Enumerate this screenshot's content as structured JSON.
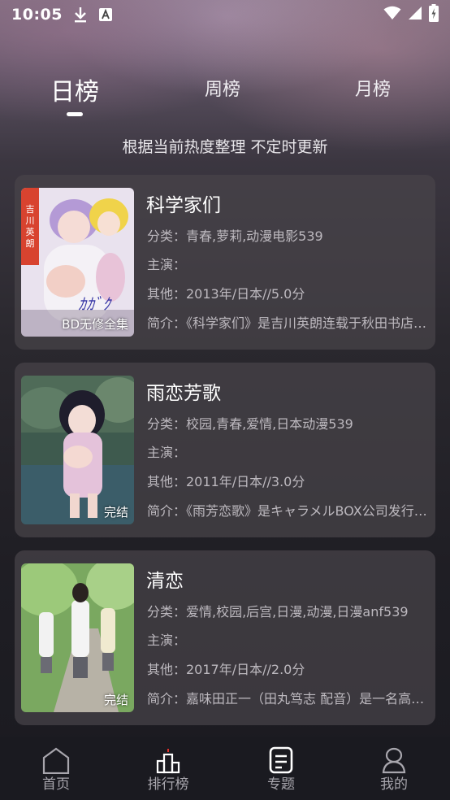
{
  "status_bar": {
    "time": "10:05",
    "icons": [
      "download-icon",
      "a-icon",
      "wifi-icon",
      "signal-icon",
      "battery-charging-icon"
    ]
  },
  "tabs": [
    {
      "label": "日榜",
      "active": true
    },
    {
      "label": "周榜",
      "active": false
    },
    {
      "label": "月榜",
      "active": false
    }
  ],
  "subtitle": "根据当前热度整理 不定时更新",
  "items": [
    {
      "title": "科学家们",
      "badge": "BD无修全集",
      "category": "分类：青春,萝莉,动漫电影539",
      "cast": "主演：",
      "other": "其他：2013年/日本//5.0分",
      "intro": "简介：《科学家们》是吉川英朗连载于秋田书店的漫画"
    },
    {
      "title": "雨恋芳歌",
      "badge": "完结",
      "category": "分类：校园,青春,爱情,日本动漫539",
      "cast": "主演：",
      "other": "其他：2011年/日本//3.0分",
      "intro": "简介：《雨芳恋歌》是キャラメルBOX公司发行的游戏"
    },
    {
      "title": "清恋",
      "badge": "完结",
      "category": "分类：爱情,校园,后宫,日漫,动漫,日漫anf539",
      "cast": "主演：",
      "other": "其他：2017年/日本//2.0分",
      "intro": "简介：嘉味田正一（田丸笃志 配音）是一名高中生"
    }
  ],
  "bottom_nav": [
    {
      "label": "首页",
      "icon": "home-icon",
      "active": false
    },
    {
      "label": "排行榜",
      "icon": "ranking-icon",
      "active": true
    },
    {
      "label": "专题",
      "icon": "topic-icon",
      "active": false
    },
    {
      "label": "我的",
      "icon": "profile-icon",
      "active": false
    }
  ],
  "colors": {
    "accent_red": "#e0302a",
    "card_bg": "#48444a",
    "text_muted": "#bdb9bf"
  }
}
